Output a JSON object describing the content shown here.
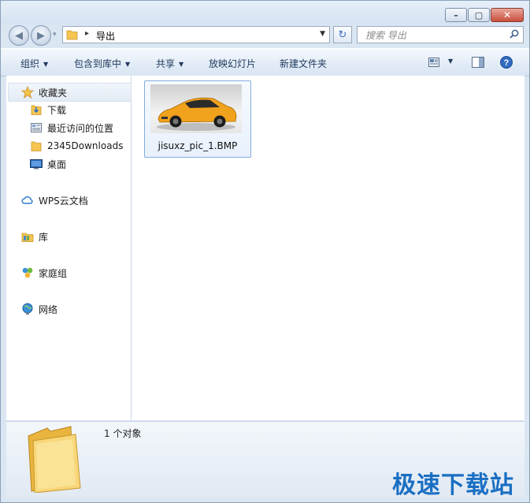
{
  "window": {
    "minimize_glyph": "–",
    "maximize_glyph": "▢",
    "close_glyph": "✕"
  },
  "navigation": {
    "back_glyph": "◀",
    "forward_glyph": "▶",
    "recent_glyph": "▾",
    "breadcrumb_separator": "▸",
    "breadcrumb": "导出",
    "refresh_glyph": "↻",
    "search_placeholder": "搜索 导出"
  },
  "toolbar": {
    "organize": "组织",
    "include_in_library": "包含到库中",
    "share": "共享",
    "slideshow": "放映幻灯片",
    "new_folder": "新建文件夹",
    "dropdown_glyph": "▼"
  },
  "sidebar": {
    "favorites": "收藏夹",
    "downloads": "下载",
    "recent_places": "最近访问的位置",
    "downloads_2345": "2345Downloads",
    "desktop": "桌面",
    "wps_cloud": "WPS云文档",
    "libraries": "库",
    "homegroup": "家庭组",
    "network": "网络"
  },
  "files": [
    {
      "name": "jisuxz_pic_1.BMP"
    }
  ],
  "details": {
    "item_count": "1 个对象"
  },
  "watermark": "极速下载站",
  "colors": {
    "accent": "#1a6fc3",
    "selection": "#84acdd",
    "folder": "#f5c451"
  }
}
